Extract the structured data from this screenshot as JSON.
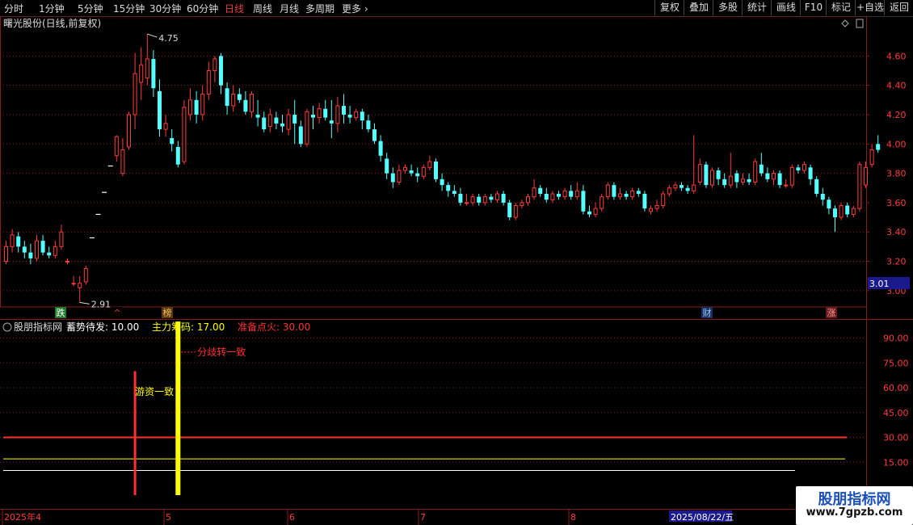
{
  "toolbar": {
    "timeframes": [
      "分时",
      "1分钟",
      "5分钟",
      "15分钟",
      "30分钟",
      "60分钟",
      "日线",
      "周线",
      "月线",
      "多周期",
      "更多"
    ],
    "active_timeframe": "日线",
    "right_buttons": [
      "复权",
      "叠加",
      "多股",
      "统计",
      "画线",
      "F10",
      "标记",
      "+自选",
      "返回"
    ]
  },
  "main_panel": {
    "stock_title": "曙光股份(日线,前复权)",
    "price_axis_labels": [
      "4.60",
      "4.40",
      "4.20",
      "4.00",
      "3.80",
      "3.60",
      "3.40",
      "3.20",
      "3.00"
    ],
    "current_price_tag": "3.01",
    "high_marker": "4.75",
    "low_marker": "2.91",
    "event_markers": [
      {
        "text": "跌",
        "bg": "#1f7a2a",
        "color": "#ffffff"
      },
      {
        "text": "^",
        "bg": "#000000",
        "color": "#e84040"
      },
      {
        "text": "榜",
        "bg": "#5a3a10",
        "color": "#f0c060"
      },
      {
        "text": "财",
        "bg": "#1a3060",
        "color": "#9cc4ff"
      },
      {
        "text": "涨",
        "bg": "#6a1a1a",
        "color": "#ff9a9a"
      }
    ]
  },
  "indicator_panel": {
    "name": "股朋指标网",
    "params": [
      {
        "label": "蓄势待发:",
        "value": "10.00",
        "color": "#ffffff"
      },
      {
        "label": "主力筹码:",
        "value": "17.00",
        "color": "#ffff00"
      },
      {
        "label": "准备点火:",
        "value": "30.00",
        "color": "#ff3030"
      }
    ],
    "axis_labels": [
      "90.00",
      "75.00",
      "60.00",
      "45.00",
      "30.00",
      "15.00"
    ],
    "annotations": [
      "分歧转一致",
      "游资一致"
    ]
  },
  "date_axis": {
    "labels": [
      "2025年4",
      "5",
      "6",
      "7",
      "8"
    ],
    "cursor_date": "2025/08/22/五"
  },
  "colors": {
    "up": "#ff3b3b",
    "down": "#54ffff",
    "grid": "#8b1a1a",
    "axis_text": "#ff3b3b"
  },
  "watermark": {
    "line1": "股朋指标网",
    "line2": "www.7gpzb.com"
  },
  "chart_data": {
    "type": "candlestick",
    "title": "曙光股份(日线,前复权)",
    "ylim": [
      2.9,
      4.8
    ],
    "candles": [
      [
        3.2,
        3.3,
        3.34,
        3.18
      ],
      [
        3.3,
        3.38,
        3.42,
        3.26
      ],
      [
        3.37,
        3.3,
        3.4,
        3.26
      ],
      [
        3.3,
        3.26,
        3.34,
        3.22
      ],
      [
        3.26,
        3.22,
        3.32,
        3.18
      ],
      [
        3.22,
        3.34,
        3.38,
        3.2
      ],
      [
        3.34,
        3.26,
        3.38,
        3.24
      ],
      [
        3.26,
        3.24,
        3.3,
        3.22
      ],
      [
        3.24,
        3.3,
        3.34,
        3.22
      ],
      [
        3.3,
        3.4,
        3.45,
        3.28
      ],
      [
        3.2,
        3.2,
        3.22,
        3.18
      ],
      [
        3.05,
        3.05,
        3.1,
        3.03
      ],
      [
        3.02,
        3.05,
        3.1,
        2.92
      ],
      [
        3.06,
        3.15,
        3.17,
        3.04
      ],
      [
        3.36,
        3.36,
        3.36,
        3.36
      ],
      [
        3.52,
        3.52,
        3.52,
        3.52
      ],
      [
        3.67,
        3.67,
        3.67,
        3.67
      ],
      [
        3.85,
        3.85,
        3.85,
        3.85
      ],
      [
        3.92,
        4.05,
        4.06,
        3.88
      ],
      [
        3.8,
        3.96,
        4.04,
        3.78
      ],
      [
        3.98,
        4.2,
        4.22,
        3.96
      ],
      [
        4.2,
        4.48,
        4.62,
        4.1
      ],
      [
        4.42,
        4.54,
        4.66,
        4.3
      ],
      [
        4.45,
        4.58,
        4.75,
        4.4
      ],
      [
        4.58,
        4.38,
        4.64,
        4.32
      ],
      [
        4.36,
        4.1,
        4.44,
        4.05
      ],
      [
        4.1,
        4.14,
        4.2,
        4.05
      ],
      [
        4.04,
        4.0,
        4.1,
        3.95
      ],
      [
        3.98,
        3.86,
        4.02,
        3.84
      ],
      [
        3.88,
        4.25,
        4.3,
        3.86
      ],
      [
        4.2,
        4.3,
        4.38,
        4.16
      ],
      [
        4.3,
        4.2,
        4.36,
        4.14
      ],
      [
        4.2,
        4.34,
        4.4,
        4.16
      ],
      [
        4.34,
        4.5,
        4.56,
        4.3
      ],
      [
        4.5,
        4.58,
        4.6,
        4.42
      ],
      [
        4.6,
        4.4,
        4.62,
        4.34
      ],
      [
        4.38,
        4.26,
        4.42,
        4.2
      ],
      [
        4.26,
        4.34,
        4.4,
        4.22
      ],
      [
        4.34,
        4.3,
        4.38,
        4.28
      ],
      [
        4.3,
        4.22,
        4.36,
        4.2
      ],
      [
        4.22,
        4.34,
        4.36,
        4.18
      ],
      [
        4.2,
        4.18,
        4.3,
        4.12
      ],
      [
        4.18,
        4.1,
        4.22,
        4.08
      ],
      [
        4.12,
        4.2,
        4.24,
        4.08
      ],
      [
        4.18,
        4.14,
        4.22,
        4.1
      ],
      [
        4.14,
        4.12,
        4.2,
        4.08
      ],
      [
        4.1,
        4.2,
        4.24,
        4.06
      ],
      [
        4.2,
        4.14,
        4.3,
        4.0
      ],
      [
        4.12,
        4.0,
        4.16,
        3.98
      ],
      [
        4.0,
        4.22,
        4.24,
        3.98
      ],
      [
        4.2,
        4.18,
        4.26,
        4.1
      ],
      [
        4.18,
        4.24,
        4.28,
        4.14
      ],
      [
        4.24,
        4.18,
        4.3,
        4.16
      ],
      [
        4.16,
        4.14,
        4.3,
        4.04
      ],
      [
        4.14,
        4.26,
        4.32,
        4.08
      ],
      [
        4.26,
        4.2,
        4.34,
        4.14
      ],
      [
        4.2,
        4.18,
        4.26,
        4.14
      ],
      [
        4.18,
        4.22,
        4.24,
        4.16
      ],
      [
        4.22,
        4.16,
        4.24,
        4.1
      ],
      [
        4.16,
        4.1,
        4.2,
        4.08
      ],
      [
        4.1,
        4.02,
        4.14,
        4.0
      ],
      [
        4.02,
        3.92,
        4.06,
        3.88
      ],
      [
        3.9,
        3.8,
        3.94,
        3.76
      ],
      [
        3.8,
        3.74,
        3.84,
        3.7
      ],
      [
        3.74,
        3.82,
        3.86,
        3.72
      ],
      [
        3.82,
        3.84,
        3.86,
        3.8
      ],
      [
        3.82,
        3.8,
        3.86,
        3.78
      ],
      [
        3.8,
        3.78,
        3.84,
        3.74
      ],
      [
        3.78,
        3.84,
        3.86,
        3.76
      ],
      [
        3.84,
        3.88,
        3.92,
        3.82
      ],
      [
        3.88,
        3.76,
        3.9,
        3.74
      ],
      [
        3.76,
        3.72,
        3.8,
        3.68
      ],
      [
        3.72,
        3.68,
        3.74,
        3.64
      ],
      [
        3.68,
        3.66,
        3.72,
        3.64
      ],
      [
        3.66,
        3.6,
        3.7,
        3.58
      ],
      [
        3.6,
        3.6,
        3.66,
        3.58
      ],
      [
        3.6,
        3.64,
        3.66,
        3.58
      ],
      [
        3.64,
        3.6,
        3.66,
        3.58
      ],
      [
        3.6,
        3.64,
        3.66,
        3.58
      ],
      [
        3.64,
        3.62,
        3.66,
        3.6
      ],
      [
        3.62,
        3.66,
        3.68,
        3.6
      ],
      [
        3.66,
        3.6,
        3.68,
        3.58
      ],
      [
        3.6,
        3.5,
        3.62,
        3.48
      ],
      [
        3.5,
        3.58,
        3.6,
        3.48
      ],
      [
        3.58,
        3.6,
        3.62,
        3.56
      ],
      [
        3.6,
        3.64,
        3.66,
        3.58
      ],
      [
        3.64,
        3.7,
        3.76,
        3.62
      ],
      [
        3.7,
        3.66,
        3.72,
        3.64
      ],
      [
        3.66,
        3.62,
        3.7,
        3.6
      ],
      [
        3.62,
        3.66,
        3.68,
        3.6
      ],
      [
        3.66,
        3.64,
        3.68,
        3.62
      ],
      [
        3.64,
        3.68,
        3.7,
        3.62
      ],
      [
        3.68,
        3.64,
        3.72,
        3.62
      ],
      [
        3.64,
        3.68,
        3.74,
        3.62
      ],
      [
        3.68,
        3.54,
        3.72,
        3.52
      ],
      [
        3.54,
        3.52,
        3.58,
        3.5
      ],
      [
        3.52,
        3.56,
        3.6,
        3.5
      ],
      [
        3.56,
        3.64,
        3.66,
        3.54
      ],
      [
        3.64,
        3.72,
        3.74,
        3.62
      ],
      [
        3.72,
        3.64,
        3.74,
        3.62
      ],
      [
        3.64,
        3.66,
        3.7,
        3.62
      ],
      [
        3.66,
        3.64,
        3.68,
        3.62
      ],
      [
        3.64,
        3.68,
        3.7,
        3.62
      ],
      [
        3.68,
        3.66,
        3.7,
        3.64
      ],
      [
        3.66,
        3.56,
        3.68,
        3.54
      ],
      [
        3.54,
        3.56,
        3.58,
        3.52
      ],
      [
        3.56,
        3.58,
        3.62,
        3.54
      ],
      [
        3.58,
        3.66,
        3.68,
        3.56
      ],
      [
        3.66,
        3.7,
        3.72,
        3.64
      ],
      [
        3.7,
        3.72,
        3.74,
        3.68
      ],
      [
        3.72,
        3.7,
        3.74,
        3.68
      ],
      [
        3.7,
        3.68,
        3.72,
        3.66
      ],
      [
        3.68,
        3.72,
        4.06,
        3.66
      ],
      [
        3.74,
        3.86,
        3.9,
        3.72
      ],
      [
        3.86,
        3.72,
        3.88,
        3.7
      ],
      [
        3.72,
        3.82,
        3.84,
        3.7
      ],
      [
        3.82,
        3.76,
        3.84,
        3.72
      ],
      [
        3.76,
        3.72,
        3.8,
        3.7
      ],
      [
        3.72,
        3.78,
        3.94,
        3.7
      ],
      [
        3.8,
        3.74,
        3.82,
        3.7
      ],
      [
        3.74,
        3.76,
        3.8,
        3.72
      ],
      [
        3.76,
        3.74,
        3.8,
        3.72
      ],
      [
        3.74,
        3.88,
        3.9,
        3.72
      ],
      [
        3.86,
        3.8,
        3.94,
        3.78
      ],
      [
        3.8,
        3.76,
        3.84,
        3.74
      ],
      [
        3.76,
        3.8,
        3.82,
        3.72
      ],
      [
        3.8,
        3.72,
        3.82,
        3.7
      ],
      [
        3.72,
        3.72,
        3.76,
        3.7
      ],
      [
        3.72,
        3.84,
        3.86,
        3.7
      ],
      [
        3.84,
        3.82,
        3.86,
        3.8
      ],
      [
        3.82,
        3.86,
        3.88,
        3.8
      ],
      [
        3.84,
        3.76,
        3.86,
        3.72
      ],
      [
        3.76,
        3.66,
        3.78,
        3.64
      ],
      [
        3.66,
        3.62,
        3.7,
        3.58
      ],
      [
        3.62,
        3.56,
        3.64,
        3.52
      ],
      [
        3.56,
        3.5,
        3.58,
        3.4
      ],
      [
        3.5,
        3.58,
        3.6,
        3.48
      ],
      [
        3.58,
        3.52,
        3.6,
        3.5
      ],
      [
        3.52,
        3.56,
        3.58,
        3.5
      ],
      [
        3.56,
        3.86,
        3.88,
        3.54
      ],
      [
        3.72,
        3.84,
        3.88,
        3.7
      ],
      [
        3.86,
        3.96,
        4.0,
        3.84
      ],
      [
        4.0,
        3.96,
        4.06,
        3.94
      ]
    ],
    "indicator": {
      "series": [
        {
          "name": "蓄势待发",
          "value": 10.0,
          "color": "#ffffff"
        },
        {
          "name": "主力筹码",
          "value": 17.0,
          "color": "#ffff00"
        },
        {
          "name": "准备点火",
          "value": 30.0,
          "color": "#ff3030"
        }
      ],
      "ylim": [
        0,
        100
      ],
      "signals": [
        {
          "candle_index": 21,
          "top": 70,
          "color": "#ff3030",
          "label": "游资一致"
        },
        {
          "candle_index": 28,
          "top": 100,
          "color": "#ffff00",
          "label": "分歧转一致"
        }
      ]
    }
  }
}
